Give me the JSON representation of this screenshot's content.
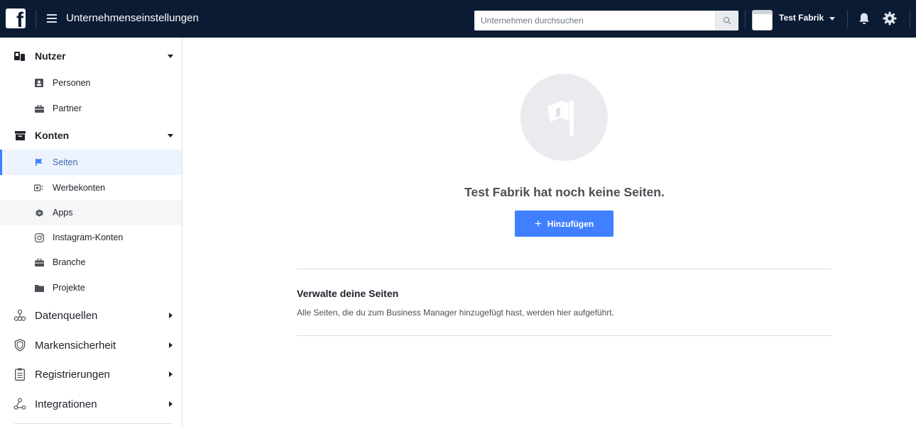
{
  "colors": {
    "topbar_bg": "#0b1b33",
    "accent": "#4080ff",
    "active_text": "#4267b2",
    "active_bg": "#ecf3ff"
  },
  "topbar": {
    "logo": "f",
    "menu_icon": "hamburger-icon",
    "title": "Unternehmenseinstellungen",
    "search_placeholder": "Unternehmen durchsuchen",
    "search_icon": "search-icon",
    "business_name": "Test Fabrik",
    "bell_icon": "bell-icon",
    "gear_icon": "gear-icon"
  },
  "sidebar": {
    "nutzer": {
      "label": "Nutzer",
      "icon": "users-icon"
    },
    "personen": {
      "label": "Personen",
      "icon": "person-card-icon"
    },
    "partner": {
      "label": "Partner",
      "icon": "briefcase-icon"
    },
    "konten": {
      "label": "Konten",
      "icon": "archive-icon"
    },
    "seiten": {
      "label": "Seiten",
      "icon": "flag-icon",
      "active": true
    },
    "werbekonten": {
      "label": "Werbekonten",
      "icon": "ad-account-icon"
    },
    "apps": {
      "label": "Apps",
      "icon": "cube-icon"
    },
    "instagram": {
      "label": "Instagram-Konten",
      "icon": "instagram-icon"
    },
    "branche": {
      "label": "Branche",
      "icon": "briefcase-icon"
    },
    "projekte": {
      "label": "Projekte",
      "icon": "folder-icon"
    },
    "datenquellen": {
      "label": "Datenquellen",
      "icon": "data-sources-icon"
    },
    "markensicherheit": {
      "label": "Markensicherheit",
      "icon": "shield-icon"
    },
    "registrierungen": {
      "label": "Registrierungen",
      "icon": "clipboard-icon"
    },
    "integrationen": {
      "label": "Integrationen",
      "icon": "integrations-icon"
    }
  },
  "main": {
    "empty_icon": "flag-icon",
    "empty_title": "Test Fabrik hat noch keine Seiten.",
    "add_button": "Hinzufügen",
    "manage_title": "Verwalte deine Seiten",
    "manage_desc": "Alle Seiten, die du zum Business Manager hinzugefügt hast, werden hier aufgeführt."
  }
}
